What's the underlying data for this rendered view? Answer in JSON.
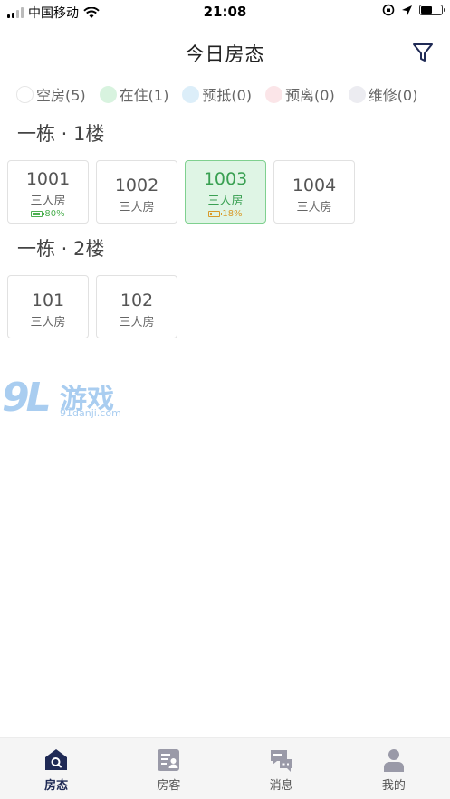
{
  "status_bar": {
    "carrier": "中国移动",
    "time": "21:08"
  },
  "header": {
    "title": "今日房态",
    "filter_icon": "funnel-icon"
  },
  "legend": [
    {
      "label": "空房(5)",
      "color": "#ffffff",
      "border": "#e6e6e6"
    },
    {
      "label": "在住(1)",
      "color": "#d8f3df",
      "border": "#d8f3df"
    },
    {
      "label": "预抵(0)",
      "color": "#dceef9",
      "border": "#dceef9"
    },
    {
      "label": "预离(0)",
      "color": "#fbe5e8",
      "border": "#fbe5e8"
    },
    {
      "label": "维修(0)",
      "color": "#ececf1",
      "border": "#ececf1"
    }
  ],
  "floors": [
    {
      "title": "一栋 · 1楼",
      "rooms": [
        {
          "number": "1001",
          "type": "三人房",
          "battery": "80%",
          "battery_level": 0.8,
          "status": "vacant"
        },
        {
          "number": "1002",
          "type": "三人房",
          "status": "vacant"
        },
        {
          "number": "1003",
          "type": "三人房",
          "battery": "18%",
          "battery_level": 0.18,
          "status": "occupied"
        },
        {
          "number": "1004",
          "type": "三人房",
          "status": "vacant"
        }
      ]
    },
    {
      "title": "一栋 · 2楼",
      "rooms": [
        {
          "number": "101",
          "type": "三人房",
          "status": "vacant"
        },
        {
          "number": "102",
          "type": "三人房",
          "status": "vacant"
        }
      ]
    }
  ],
  "watermark": {
    "mark": "9L",
    "text": "游戏",
    "url": "91danji.com"
  },
  "tabbar": [
    {
      "label": "房态",
      "icon": "house-search-icon",
      "active": true
    },
    {
      "label": "房客",
      "icon": "guest-list-icon",
      "active": false
    },
    {
      "label": "消息",
      "icon": "chat-icon",
      "active": false
    },
    {
      "label": "我的",
      "icon": "person-icon",
      "active": false
    }
  ]
}
